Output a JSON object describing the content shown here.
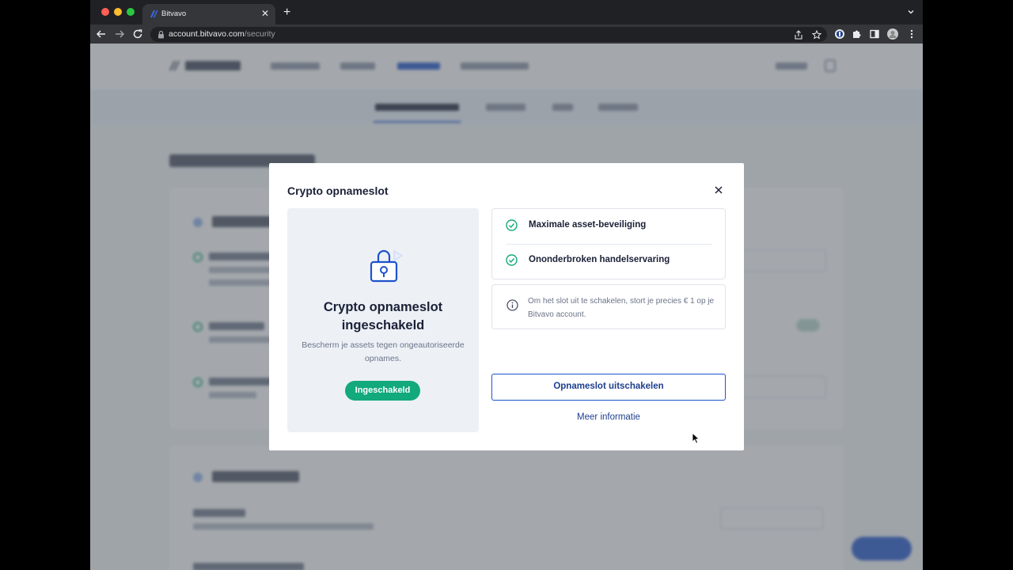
{
  "browser": {
    "tab_title": "Bitvavo",
    "url_host": "account.bitvavo.com",
    "url_path": "/security",
    "icons": [
      "back-icon",
      "forward-icon",
      "reload-icon",
      "lock-icon",
      "share-icon",
      "star-icon",
      "extension-icon",
      "puzzle-icon",
      "sidebar-icon",
      "profile-icon",
      "menu-icon"
    ]
  },
  "modal": {
    "title": "Crypto opnameslot",
    "panel": {
      "title": "Crypto opnameslot ingeschakeld",
      "description": "Bescherm je assets tegen ongeautoriseerde opnames.",
      "status_label": "Ingeschakeld"
    },
    "features": [
      {
        "label": "Maximale asset-beveiliging"
      },
      {
        "label": "Ononderbroken handelservaring"
      }
    ],
    "info_text": "Om het slot uit te schakelen, stort je precies € 1 op je Bitvavo account.",
    "primary_button": "Opnameslot uitschakelen",
    "secondary_link": "Meer informatie"
  },
  "colors": {
    "brand_blue": "#1e52cc",
    "success_green": "#12a97c",
    "text_dark": "#1b2137"
  }
}
